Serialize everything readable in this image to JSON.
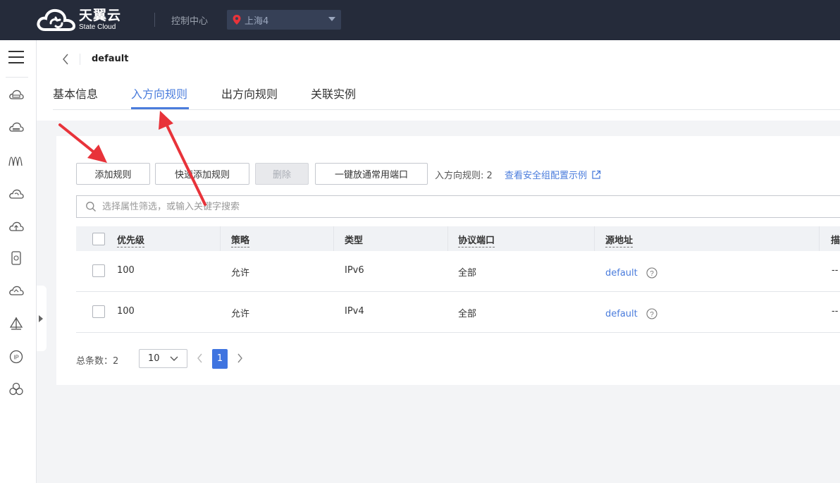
{
  "brand": {
    "name_cn": "天翼云",
    "name_en": "State Cloud"
  },
  "topbar": {
    "console_label": "控制中心",
    "region_label": "上海4"
  },
  "page": {
    "title": "default"
  },
  "tabs": [
    {
      "label": "基本信息",
      "active": false
    },
    {
      "label": "入方向规则",
      "active": true
    },
    {
      "label": "出方向规则",
      "active": false
    },
    {
      "label": "关联实例",
      "active": false
    }
  ],
  "toolbar": {
    "add_rule": "添加规则",
    "quick_add_rule": "快速添加规则",
    "delete": "删除",
    "open_common_ports": "一键放通常用端口",
    "rule_count_text": "入方向规则: 2",
    "example_link": "查看安全组配置示例"
  },
  "search": {
    "placeholder": "选择属性筛选，或输入关键字搜索"
  },
  "table": {
    "columns": [
      "优先级",
      "策略",
      "类型",
      "协议端口",
      "源地址",
      "描"
    ],
    "rows": [
      {
        "priority": "100",
        "policy": "允许",
        "type": "IPv6",
        "protocol_port": "全部",
        "source": "default",
        "desc": "--"
      },
      {
        "priority": "100",
        "policy": "允许",
        "type": "IPv4",
        "protocol_port": "全部",
        "source": "default",
        "desc": "--"
      }
    ]
  },
  "pagination": {
    "total_text": "总条数：2",
    "page_size": "10",
    "current_page": "1"
  },
  "colors": {
    "topbar": "#252b3a",
    "accent": "#4a7cdc",
    "annotation_arrow": "#e8333a"
  }
}
